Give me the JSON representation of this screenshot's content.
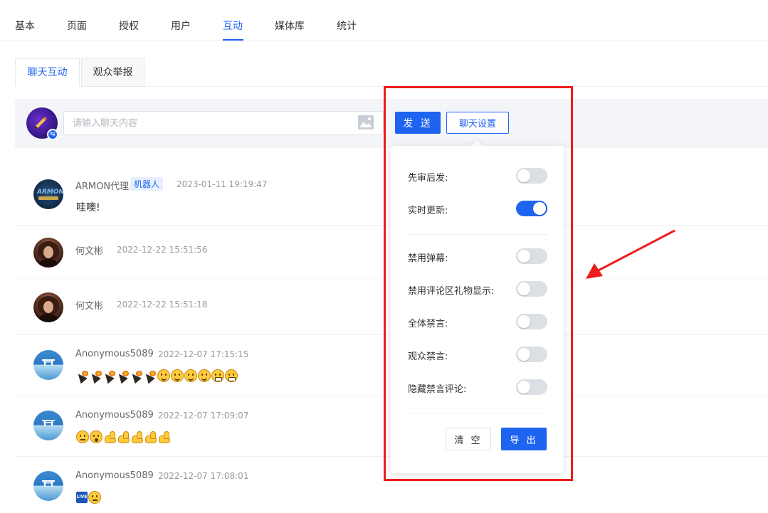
{
  "top_tabs": [
    "基本",
    "页面",
    "授权",
    "用户",
    "互动",
    "媒体库",
    "统计"
  ],
  "active_top_tab": "互动",
  "sub_tabs": [
    "聊天互动",
    "观众举报"
  ],
  "active_sub_tab": "聊天互动",
  "compose": {
    "placeholder": "请输入聊天内容",
    "send_label": "发 送",
    "settings_label": "聊天设置"
  },
  "messages": [
    {
      "name": "ARMON代理",
      "tag": "机器人",
      "time": "2023-01-11 19:19:47",
      "text": "哇噢!",
      "avatar_icon": "armon-logo"
    },
    {
      "name": "何文彬",
      "time": "2022-12-22 15:51:56",
      "text": "",
      "avatar_icon": "portrait-photo"
    },
    {
      "name": "何文彬",
      "time": "2022-12-22 15:51:18",
      "text": "",
      "avatar_icon": "portrait-photo"
    },
    {
      "name": "Anonymous5089",
      "time": "2022-12-07 17:15:15",
      "emojis": [
        "party-popper",
        "party-popper",
        "party-popper",
        "party-popper",
        "party-popper",
        "party-popper",
        "smile",
        "smile",
        "smile",
        "smile",
        "grin",
        "grin"
      ]
    },
    {
      "name": "Anonymous5089",
      "time": "2022-12-07 17:09:07",
      "emojis": [
        "neutral",
        "wow",
        "flexed-biceps",
        "flexed-biceps",
        "flexed-biceps",
        "flexed-biceps",
        "flexed-biceps"
      ]
    },
    {
      "name": "Anonymous5089",
      "time": "2022-12-07 17:08:01",
      "emojis": [
        "live-badge",
        "neutral"
      ]
    }
  ],
  "settings": {
    "rows": [
      {
        "label": "先审后发:",
        "on": false
      },
      {
        "label": "实时更新:",
        "on": true
      },
      {
        "label": "禁用弹幕:",
        "on": false
      },
      {
        "label": "禁用评论区礼物显示:",
        "on": false
      },
      {
        "label": "全体禁言:",
        "on": false
      },
      {
        "label": "观众禁言:",
        "on": false
      },
      {
        "label": "隐藏禁言评论:",
        "on": false
      }
    ],
    "clear_label": "清 空",
    "export_label": "导 出"
  },
  "colors": {
    "accent": "#1f64f0",
    "annotation": "#ee1c1c"
  }
}
